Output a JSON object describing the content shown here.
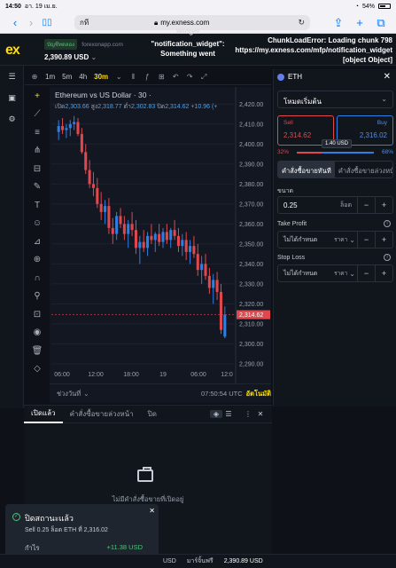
{
  "status": {
    "time": "14:50",
    "date": "อา. 19 เม.ย.",
    "battery": "54%"
  },
  "safari": {
    "aa": "กที",
    "url": "my.exness.com"
  },
  "header": {
    "account_type": "บัญชีทดลอง",
    "broker": "forexonapp.com",
    "balance": "2,390.89 USD",
    "error_widget": "\"notification_widget\": Something went",
    "error_widget_top": "Widget",
    "error_chunk": "ChunkLoadError: Loading chunk 798 https://my.exness.com/mfp/notification_widget [object Object]"
  },
  "chart_toolbar": {
    "timeframes": [
      "1m",
      "5m",
      "4h",
      "30m"
    ],
    "active_tf": "30m"
  },
  "chart": {
    "title": "Ethereum vs US Dollar · 30 ·",
    "ohlc": {
      "o_label": "เปิด",
      "o": "2,303.66",
      "h_label": "สูง",
      "h": "2,318.77",
      "l_label": "ต่ำ",
      "l": "2,302.83",
      "c_label": "ปิด",
      "c": "2,314.62",
      "chg": "+10.96 (+"
    },
    "current_price": "2,314.62",
    "x_labels": [
      "06:00",
      "12:00",
      "18:00",
      "19",
      "06:00",
      "12:0"
    ],
    "range_label": "ช่วงวันที่",
    "clock": "07:50:54 UTC",
    "auto": "อัตโนมัติ"
  },
  "chart_data": {
    "type": "candlestick",
    "ylim": [
      2290,
      2425
    ],
    "y_ticks": [
      2420,
      2410,
      2400,
      2390,
      2380,
      2370,
      2360,
      2350,
      2340,
      2330,
      2320,
      2310,
      2300,
      2290
    ],
    "x_ticks": [
      "06:00",
      "12:00",
      "18:00",
      "19",
      "06:00",
      "12:0"
    ],
    "candles": [
      [
        2406,
        2412,
        2402,
        2409
      ],
      [
        2409,
        2413,
        2405,
        2407
      ],
      [
        2407,
        2410,
        2403,
        2408
      ],
      [
        2408,
        2412,
        2404,
        2410
      ],
      [
        2410,
        2414,
        2407,
        2411
      ],
      [
        2411,
        2413,
        2404,
        2405
      ],
      [
        2405,
        2408,
        2395,
        2396
      ],
      [
        2396,
        2400,
        2385,
        2387
      ],
      [
        2387,
        2392,
        2378,
        2380
      ],
      [
        2380,
        2386,
        2374,
        2378
      ],
      [
        2378,
        2383,
        2368,
        2370
      ],
      [
        2370,
        2376,
        2362,
        2366
      ],
      [
        2366,
        2372,
        2360,
        2369
      ],
      [
        2369,
        2373,
        2355,
        2358
      ],
      [
        2358,
        2363,
        2350,
        2355
      ],
      [
        2355,
        2366,
        2352,
        2364
      ],
      [
        2364,
        2368,
        2358,
        2360
      ],
      [
        2360,
        2364,
        2352,
        2355
      ],
      [
        2355,
        2362,
        2348,
        2360
      ],
      [
        2360,
        2366,
        2354,
        2357
      ],
      [
        2357,
        2362,
        2345,
        2348
      ],
      [
        2348,
        2354,
        2340,
        2351
      ],
      [
        2351,
        2357,
        2346,
        2348
      ],
      [
        2348,
        2356,
        2344,
        2354
      ],
      [
        2354,
        2360,
        2350,
        2352
      ],
      [
        2352,
        2356,
        2346,
        2355
      ],
      [
        2355,
        2360,
        2349,
        2351
      ],
      [
        2351,
        2358,
        2348,
        2356
      ],
      [
        2356,
        2360,
        2350,
        2352
      ],
      [
        2352,
        2358,
        2348,
        2357
      ],
      [
        2357,
        2362,
        2352,
        2354
      ],
      [
        2354,
        2358,
        2346,
        2349
      ],
      [
        2349,
        2355,
        2344,
        2352
      ],
      [
        2352,
        2356,
        2342,
        2346
      ],
      [
        2346,
        2352,
        2340,
        2349
      ],
      [
        2349,
        2354,
        2343,
        2345
      ],
      [
        2345,
        2350,
        2334,
        2337
      ],
      [
        2337,
        2344,
        2330,
        2340
      ],
      [
        2340,
        2345,
        2332,
        2334
      ],
      [
        2334,
        2338,
        2325,
        2328
      ],
      [
        2328,
        2335,
        2320,
        2332
      ],
      [
        2332,
        2336,
        2322,
        2326
      ],
      [
        2326,
        2330,
        2305,
        2307
      ],
      [
        2303.66,
        2318.77,
        2302.83,
        2314.62
      ]
    ]
  },
  "panel": {
    "symbol": "ETH",
    "mode": "โหมดเริ่มต้น",
    "sell_label": "Sell",
    "sell_price": "2,314.62",
    "buy_label": "Buy",
    "buy_price": "2,316.02",
    "spread": "1.40 USD",
    "sentiment_sell": "32%",
    "sentiment_buy": "68%",
    "sentiment_sell_fraction": 0.32,
    "tab_market": "คำสั่งซื้อขายทันที",
    "tab_pending": "คำสั่งซื้อขายล่วงหน้า",
    "volume_label": "ขนาด",
    "volume_value": "0.25",
    "volume_unit": "ล็อต",
    "tp_label": "Take Profit",
    "tp_value": "ไม่ได้กำหนด",
    "tp_mode": "ราคา",
    "sl_label": "Stop Loss",
    "sl_value": "ไม่ได้กำหนด",
    "sl_mode": "ราคา"
  },
  "bottom": {
    "tab_open": "เปิดแล้ว",
    "tab_pending": "คำสั่งซื้อขายล่วงหน้า",
    "tab_closed": "ปิด",
    "empty_text": "ไม่มีคำสั่งซื้อขายที่เปิดอยู่"
  },
  "toast": {
    "title": "ปิดสถานะแล้ว",
    "text": "Sell 0.25 ล็อต ETH ที่ 2,316.02",
    "profit_label": "กำไร",
    "profit_value": "+11.38 USD"
  },
  "footer": {
    "usd_label": "USD",
    "margin_label": "มาร์จิ้นฟรี",
    "margin_value": "2,390.89 USD"
  }
}
